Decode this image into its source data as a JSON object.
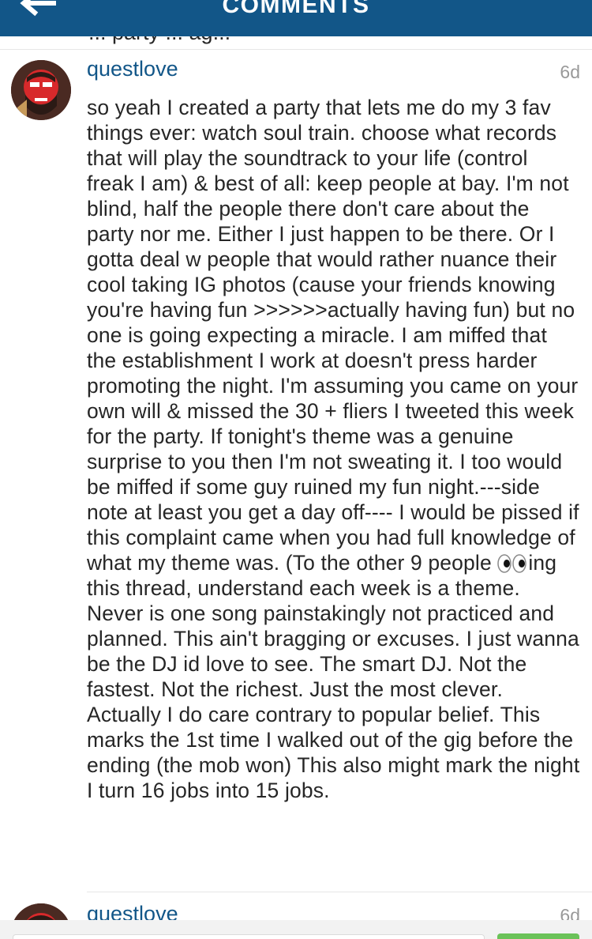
{
  "header": {
    "title": "COMMENTS",
    "back_icon": "back-arrow-icon",
    "background": "#125688"
  },
  "previous_comment": {
    "partial_text": "...  party ... ag..."
  },
  "comments": [
    {
      "username": "questlove",
      "time": "6d",
      "text_before_emoji": "so yeah I created a party that lets me do my 3 fav things ever: watch soul train. choose what records that will play the soundtrack to your life (control freak I am) & best of all: keep people at bay. I'm not blind, half the people there don't care about the party nor me. Either I just happen to be there. Or I gotta deal w people that would rather nuance their cool taking IG photos (cause your friends knowing you're having fun >>>>>>actually having fun) but no one is going expecting a miracle. I am miffed that the establishment I work at doesn't press harder promoting the night. I'm assuming you came on your own will & missed the 30 + fliers I tweeted this week for the party. If tonight's theme was a genuine surprise to you then I'm not sweating it. I too would be miffed if some guy ruined my fun night.---side note at least you get a day off---- I would be pissed if this complaint came when you had full knowledge of what my theme was. (To the other 9 people ",
      "emoji": "eyes-emoji",
      "text_after_emoji": "ing this thread, understand each week is a theme. Never is one song painstakingly not practiced and planned. This ain't bragging or excuses. I just wanna be the DJ id love to see. The smart DJ. Not the fastest. Not the richest. Just the most clever. Actually I do care contrary to popular belief. This marks the 1st time I walked out of the gig before the ending (the mob won) This also might mark the night I turn 16 jobs into 15 jobs."
    },
    {
      "username": "questlove",
      "time": "6d"
    }
  ],
  "colors": {
    "username": "#125688",
    "text": "#262626",
    "time": "#999999",
    "send_button": "#6bc259"
  }
}
